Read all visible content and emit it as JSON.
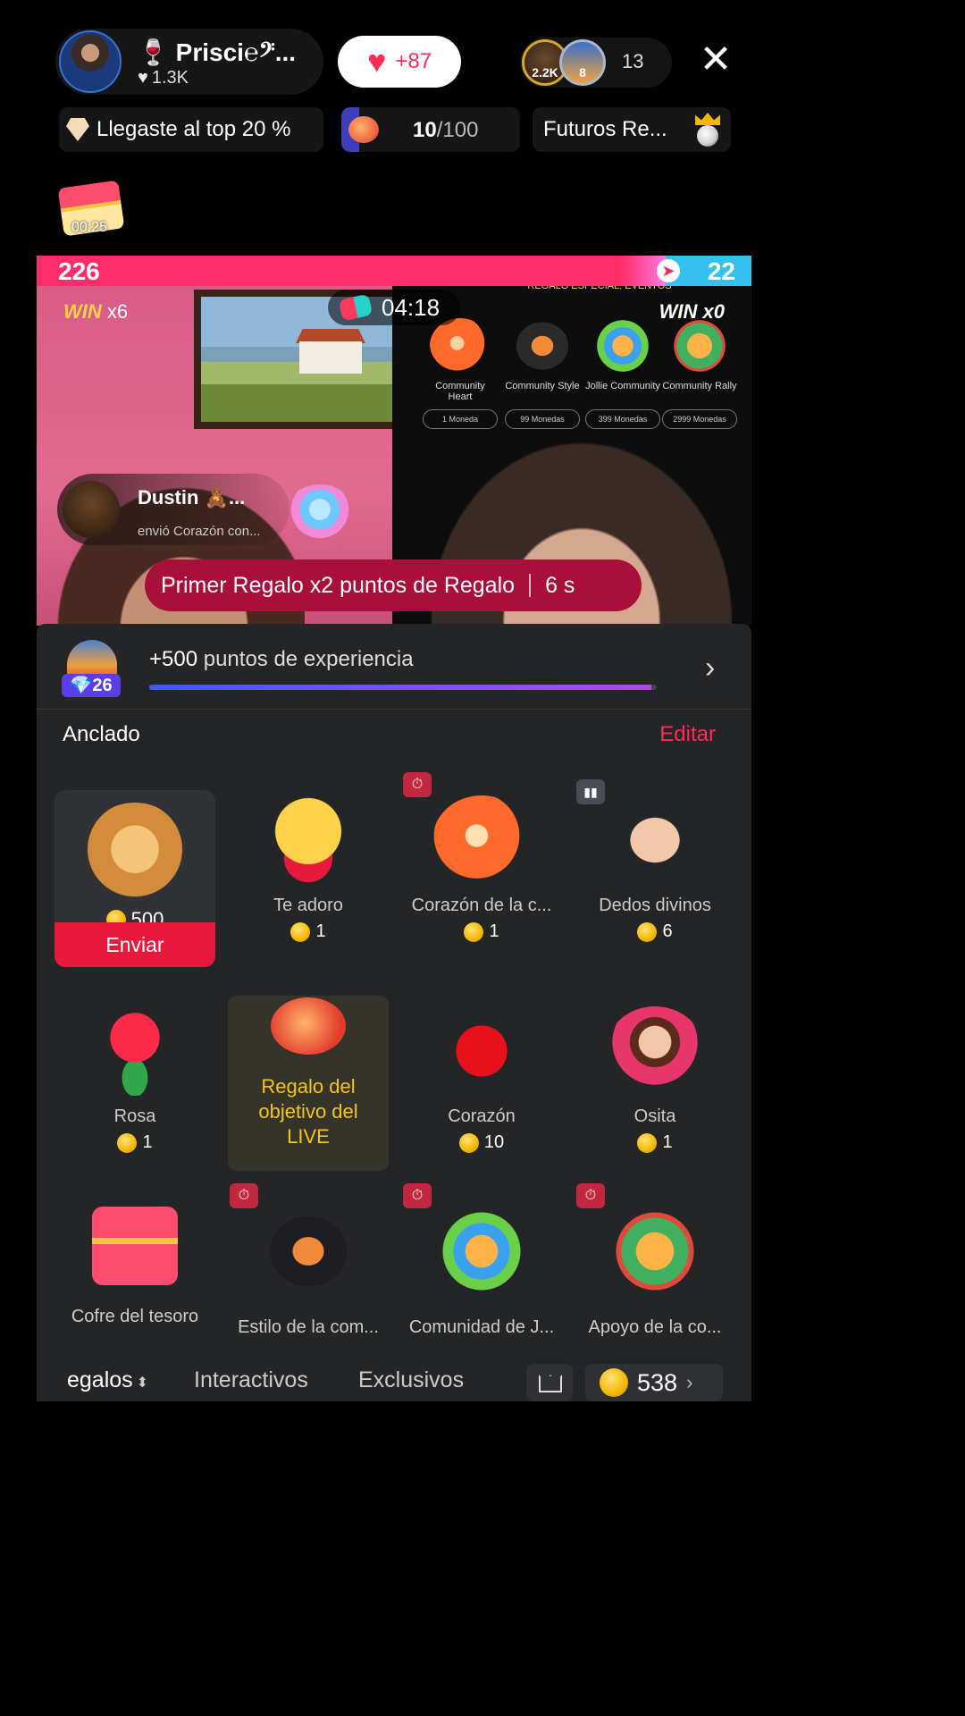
{
  "host": {
    "name": "🍷 Prisci℮𝄢...",
    "likes": "1.3K",
    "follow_heart_count": "+87"
  },
  "viewers": {
    "top1_badge": "2.2K",
    "top2_badge": "8",
    "count": "13"
  },
  "info_row": {
    "rank_text": "Llegaste al top 20 %",
    "goal_current": "10",
    "goal_total": "/100",
    "event_label": "Futuros Re..."
  },
  "chest_timer": "00:25",
  "battle": {
    "left_score": "226",
    "right_score": "22",
    "win_left_label": "WIN",
    "win_left_mult": "x6",
    "win_right": "WIN x0",
    "timer": "04:18",
    "event_title": "REGALO ESPECIAL: EVENTOS"
  },
  "event_gifts": [
    {
      "name": "Community Heart",
      "price": "1 Moneda"
    },
    {
      "name": "Community Style",
      "price": "99 Monedas"
    },
    {
      "name": "Jollie Community",
      "price": "399 Monedas"
    },
    {
      "name": "Community Rally",
      "price": "2999 Monedas"
    }
  ],
  "gift_notice": {
    "user": "Dustin 🧸...",
    "action": "envió  Corazón con..."
  },
  "banner": {
    "text": "Primer Regalo x2 puntos de Regalo",
    "countdown": "6 s"
  },
  "xp": {
    "level": "26",
    "amount": "+500",
    "label": "puntos de experiencia",
    "progress": 0.99
  },
  "pinned": {
    "title": "Anclado",
    "edit": "Editar"
  },
  "selected_gift": {
    "price": "500",
    "send_label": "Enviar"
  },
  "gifts": [
    {
      "name": "Te adoro",
      "price": "1"
    },
    {
      "name": "Corazón de la c...",
      "price": "1"
    },
    {
      "name": "Dedos divinos",
      "price": "6"
    },
    {
      "name": "Rosa",
      "price": "1"
    },
    {
      "name": "Corazón",
      "price": "10"
    },
    {
      "name": "Osita",
      "price": "1"
    },
    {
      "name": "Cofre del tesoro",
      "price": ""
    },
    {
      "name": "Estilo de la com...",
      "price": ""
    },
    {
      "name": "Comunidad de J...",
      "price": ""
    },
    {
      "name": "Apoyo de la co...",
      "price": ""
    }
  ],
  "goal_gift_text": "Regalo del objetivo del LIVE",
  "tabs": {
    "gifts": "egalos",
    "interactive": "Interactivos",
    "exclusive": "Exclusivos"
  },
  "balance": "538",
  "colors": {
    "accent": "#fe2c55",
    "send_button": "#e8193c",
    "gold_text": "#f5c518",
    "panel_bg": "#232526"
  }
}
